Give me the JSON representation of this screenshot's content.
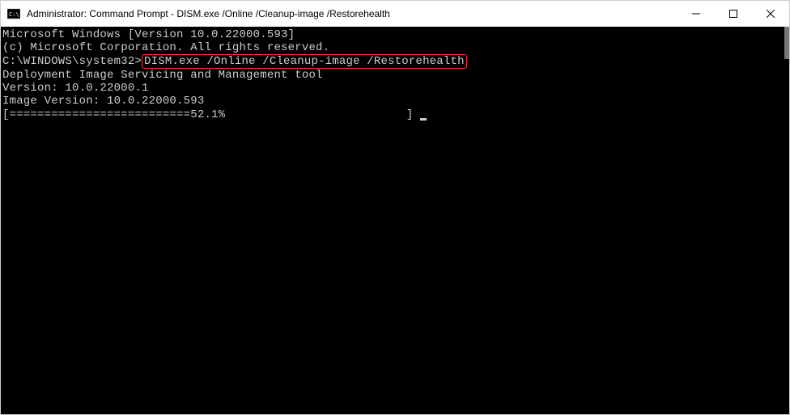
{
  "titlebar": {
    "title": "Administrator: Command Prompt - DISM.exe  /Online /Cleanup-image /Restorehealth"
  },
  "terminal": {
    "line1": "Microsoft Windows [Version 10.0.22000.593]",
    "line2": "(c) Microsoft Corporation. All rights reserved.",
    "blank1": "",
    "prompt": "C:\\WINDOWS\\system32>",
    "command": "DISM.exe /Online /Cleanup-image /Restorehealth",
    "blank2": "",
    "tool1": "Deployment Image Servicing and Management tool",
    "tool2": "Version: 10.0.22000.1",
    "blank3": "",
    "imgversion": "Image Version: 10.0.22000.593",
    "blank4": "",
    "progress_left": "[==========================52.1%",
    "progress_right": "                          ] "
  }
}
